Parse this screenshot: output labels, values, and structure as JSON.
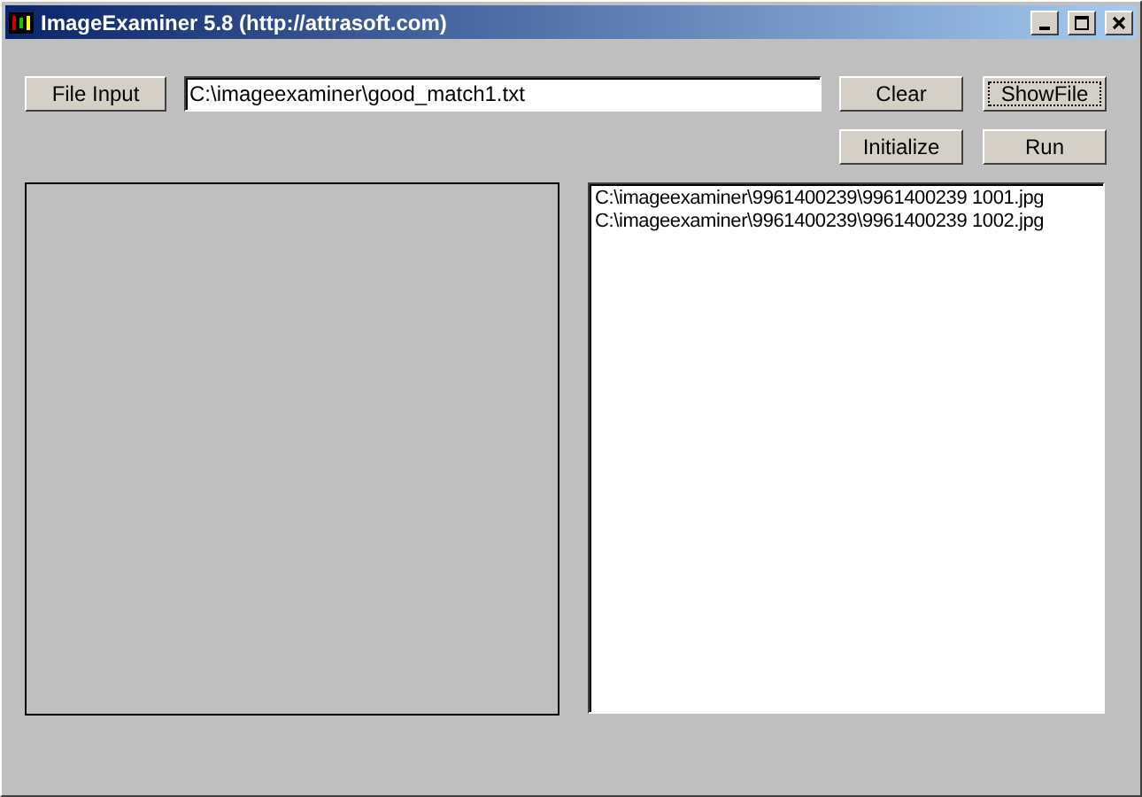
{
  "window": {
    "title": "ImageExaminer 5.8 (http://attrasoft.com)"
  },
  "file_input_button": {
    "label": "File Input"
  },
  "file_path_field": {
    "value": "C:\\imageexaminer\\good_match1.txt"
  },
  "buttons": [
    {
      "label": "Clear",
      "focused": false
    },
    {
      "label": "ShowFile",
      "focused": true
    },
    {
      "label": "Initialize",
      "focused": false
    },
    {
      "label": "Run",
      "focused": false
    }
  ],
  "results_list": {
    "items": [
      "C:\\imageexaminer\\9961400239\\9961400239 1001.jpg",
      "C:\\imageexaminer\\9961400239\\9961400239 1002.jpg"
    ]
  }
}
